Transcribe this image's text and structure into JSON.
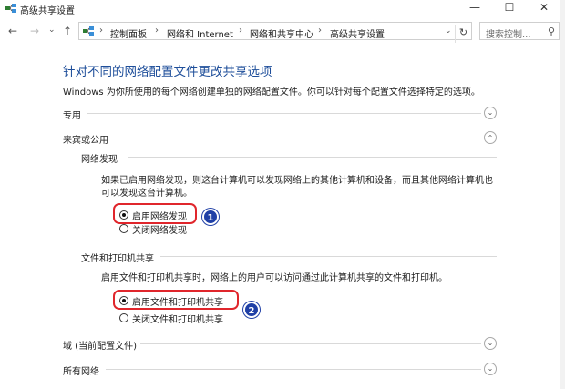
{
  "window": {
    "title": "高级共享设置",
    "minimize": "—",
    "maximize": "☐",
    "close": "✕"
  },
  "nav": {
    "back": "←",
    "forward": "→",
    "dropdown": "⌄",
    "up": "↑"
  },
  "address": {
    "crumbs": [
      "控制面板",
      "网络和 Internet",
      "网络和共享中心",
      "高级共享设置"
    ],
    "separator": "›",
    "refresh": "↻",
    "dropdown": "⌄"
  },
  "search": {
    "placeholder": "搜索控制...",
    "icon": "⚲"
  },
  "content": {
    "heading": "针对不同的网络配置文件更改共享选项",
    "description": "Windows 为你所使用的每个网络创建单独的网络配置文件。你可以针对每个配置文件选择特定的选项。",
    "profiles": {
      "private": {
        "label": "专用",
        "chevron": "⌄"
      },
      "guest_public": {
        "label": "来宾或公用",
        "chevron": "⌃"
      },
      "domain": {
        "label": "域 (当前配置文件)",
        "chevron": "⌄"
      },
      "all": {
        "label": "所有网络",
        "chevron": "⌄"
      }
    },
    "network_discovery": {
      "title": "网络发现",
      "text_line1": "如果已启用网络发现，则这台计算机可以发现网络上的其他计算机和设备，而且其他网络计算机也",
      "text_line2": "可以发现这台计算机。",
      "option_on": "启用网络发现",
      "option_off": "关闭网络发现",
      "selected": "on"
    },
    "file_printer_sharing": {
      "title": "文件和打印机共享",
      "text": "启用文件和打印机共享时，网络上的用户可以访问通过此计算机共享的文件和打印机。",
      "option_on": "启用文件和打印机共享",
      "option_off": "关闭文件和打印机共享",
      "selected": "on"
    }
  },
  "annotations": {
    "badge1": "1",
    "badge2": "2"
  },
  "colors": {
    "heading": "#1e4e9a",
    "callout": "#e0262c",
    "badge": "#1f3fa6"
  }
}
